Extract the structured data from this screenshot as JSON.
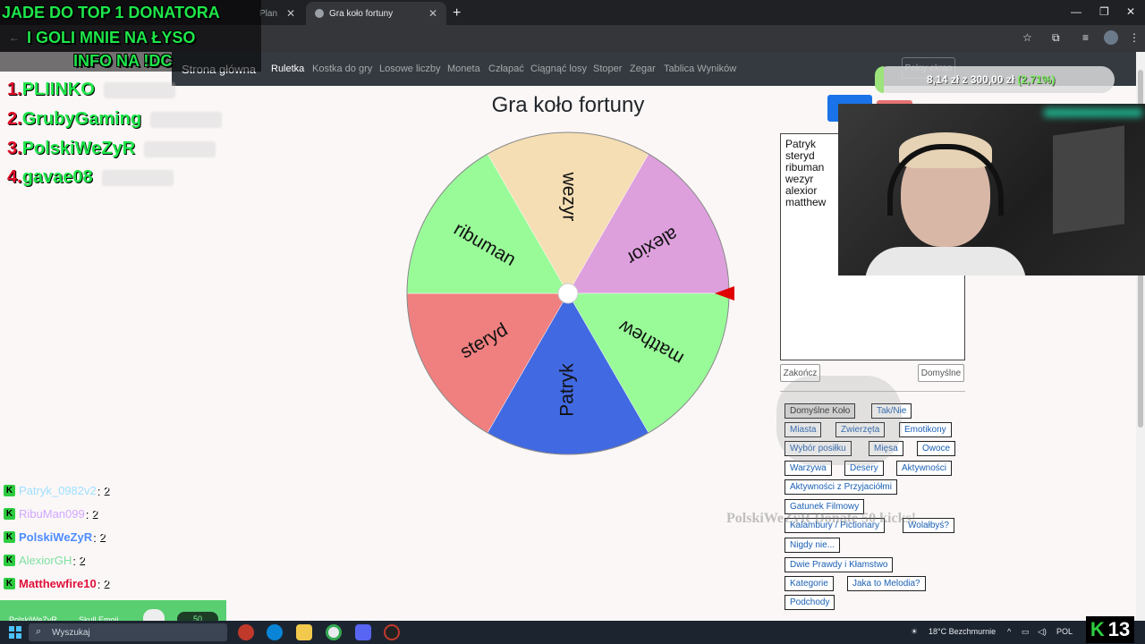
{
  "browser": {
    "tab_inactive_label": "Plan",
    "tab_active_label": "Gra koło fortuny",
    "new_tab": "+",
    "window_controls": [
      "—",
      "❐",
      "✕"
    ]
  },
  "navbar": {
    "brand": "Strona główna",
    "links": [
      "Ruletka",
      "Kostka do gry",
      "Losowe liczby",
      "Moneta",
      "Człapać",
      "Ciągnąć losy",
      "Stoper",
      "Zegar",
      "Tablica Wyników"
    ],
    "fullscreen": "Pełny ekran"
  },
  "game": {
    "title": "Gra koło fortuny",
    "names": [
      "Patryk",
      "steryd",
      "ribuman",
      "wezyr",
      "alexior",
      "matthew"
    ],
    "finish_button": "Zakończ",
    "default_button": "Domyślne",
    "presets": [
      "Domyślne Koło",
      "Tak/Nie",
      "Miasta",
      "Zwierzęta",
      "Emotikony",
      "Wybór posiłku",
      "Mięsa",
      "Owoce",
      "Warzywa",
      "Desery",
      "Aktywności",
      "Aktywności z Przyjaciółmi",
      "Gatunek Filmowy",
      "Kalambury / Pictionary",
      "Wolałbyś?",
      "Nigdy nie...",
      "Dwie Prawdy i Kłamstwo",
      "Kategorie",
      "Jaka to Melodia?",
      "Podchody"
    ]
  },
  "wheel": {
    "segments": [
      {
        "label": "wezyr",
        "color": "#f5deb3"
      },
      {
        "label": "alexior",
        "color": "#dda0dd"
      },
      {
        "label": "matthew",
        "color": "#98fb98"
      },
      {
        "label": "Patryk",
        "color": "#4169e1"
      },
      {
        "label": "steryd",
        "color": "#f08080"
      },
      {
        "label": "ribuman",
        "color": "#98fb98"
      }
    ],
    "pointer_color": "#e00000"
  },
  "overlay": {
    "headline_lines": [
      "JADE DO TOP 1 DONATORA",
      "I GOLI MNIE NA ŁYSO",
      "INFO NA !DC"
    ],
    "top_donors": [
      {
        "rank": "1.",
        "name": "PLIINKO"
      },
      {
        "rank": "2.",
        "name": "GrubyGaming"
      },
      {
        "rank": "3.",
        "name": "PolskiWeZyR"
      },
      {
        "rank": "4.",
        "name": "gavae08"
      }
    ],
    "goal_text": "8,14 zł z 300,00 zł",
    "goal_percent": "(2,71%)",
    "goal_fraction": 0.0271,
    "chat": [
      {
        "user": "Patryk_0982v2",
        "msg": ": 2",
        "color": "#9fe0ff"
      },
      {
        "user": "RibuMan099",
        "msg": ": 2",
        "color": "#d0a7ff"
      },
      {
        "user": "PolskiWeZyR",
        "msg": ": 2",
        "color": "#4d8dff"
      },
      {
        "user": "AlexiorGH",
        "msg": ": 2",
        "color": "#7fe0a0"
      },
      {
        "user": "Matthewfire10",
        "msg": ": 2",
        "color": "#e0103a"
      }
    ],
    "alert_user": "PolskiWeZyR",
    "alert_text": "Skull Emoji",
    "alert_count": "50",
    "watermark": "PolskiWeZyR Donate 50 kicks!"
  },
  "taskbar": {
    "search_placeholder": "Wyszukaj",
    "weather": "18°C  Bezchmurnie",
    "lang": "POL",
    "kick_number": "13"
  }
}
